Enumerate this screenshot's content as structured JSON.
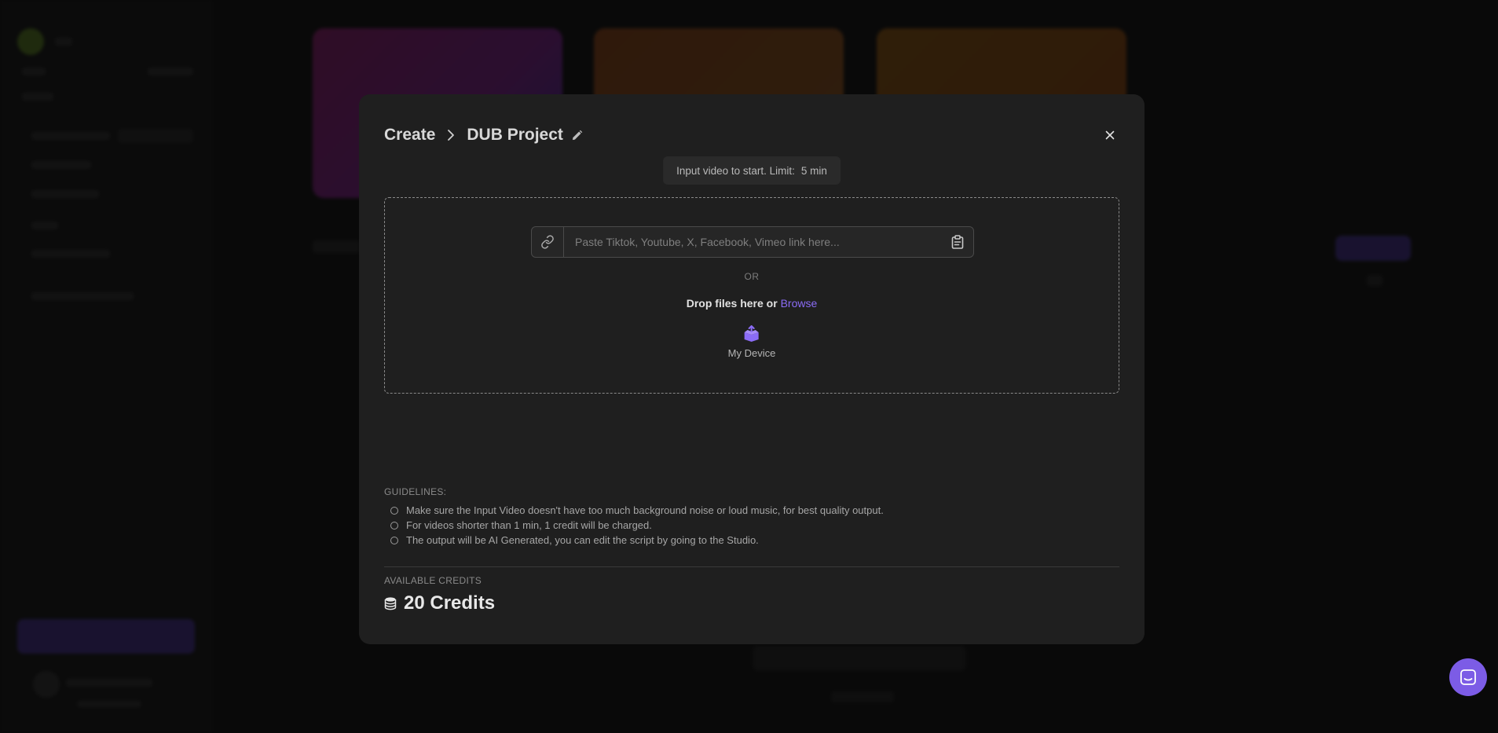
{
  "modal": {
    "breadcrumb": {
      "root": "Create",
      "current": "DUB Project"
    },
    "limit": {
      "label": "Input video to start. Limit:",
      "value": "5 min"
    },
    "link_input": {
      "placeholder": "Paste Tiktok, Youtube, X, Facebook, Vimeo link here..."
    },
    "or_text": "OR",
    "drop": {
      "text": "Drop files here or",
      "browse": "Browse"
    },
    "device_label": "My Device",
    "guidelines": {
      "title": "GUIDELINES:",
      "items": [
        "Make sure the Input Video doesn't have too much background noise or loud music, for best quality output.",
        "For videos shorter than 1 min, 1 credit will be charged.",
        "The output will be AI Generated, you can edit the script by going to the Studio."
      ]
    },
    "credits": {
      "label": "AVAILABLE CREDITS",
      "value": "20 Credits"
    }
  },
  "icons": {
    "breadcrumb_separator": "chevron-right-icon",
    "edit": "pencil-icon",
    "close": "close-icon",
    "link": "link-icon",
    "paste": "clipboard-icon",
    "device": "upload-box-icon",
    "credits": "coins-icon",
    "chat": "chat-icon"
  },
  "colors": {
    "accent": "#8b6cf6",
    "modal_bg": "#1f1f1f",
    "chat_fab": "#7c5ce6"
  }
}
